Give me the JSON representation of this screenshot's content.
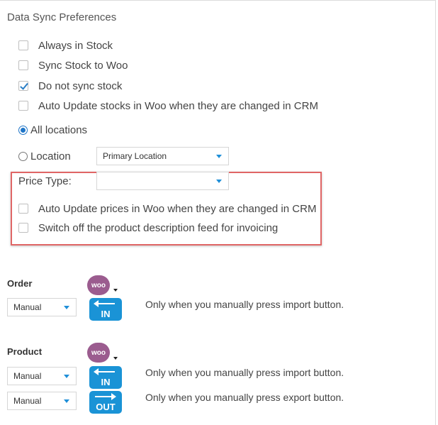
{
  "section_title": "Data Sync Preferences",
  "stock_options": [
    {
      "label": "Always in Stock",
      "checked": false
    },
    {
      "label": "Sync Stock to Woo",
      "checked": false
    },
    {
      "label": "Do not sync stock",
      "checked": true
    },
    {
      "label": "Auto Update stocks in Woo when they are changed in CRM",
      "checked": false
    }
  ],
  "location": {
    "all_locations_label": "All locations",
    "all_locations_selected": true,
    "location_label": "Location",
    "location_selected": false,
    "location_value": "Primary Location"
  },
  "price": {
    "label": "Price Type:",
    "value": ""
  },
  "price_options": [
    {
      "label": "Auto Update prices in Woo when they are changed in CRM",
      "checked": false
    },
    {
      "label": "Switch off the product description feed for invoicing",
      "checked": false
    }
  ],
  "order": {
    "label": "Order",
    "woo_badge": "woo",
    "mode": "Manual",
    "button": "IN",
    "description": "Only when you manually press import button."
  },
  "product": {
    "label": "Product",
    "woo_badge": "woo",
    "import_mode": "Manual",
    "import_button": "IN",
    "import_description": "Only when you manually press import button.",
    "export_mode": "Manual",
    "export_button": "OUT",
    "export_description": "Only when you manually press export button."
  },
  "colors": {
    "accent": "#1a93d6",
    "woo": "#9b5c8f",
    "highlight": "#e06666"
  }
}
